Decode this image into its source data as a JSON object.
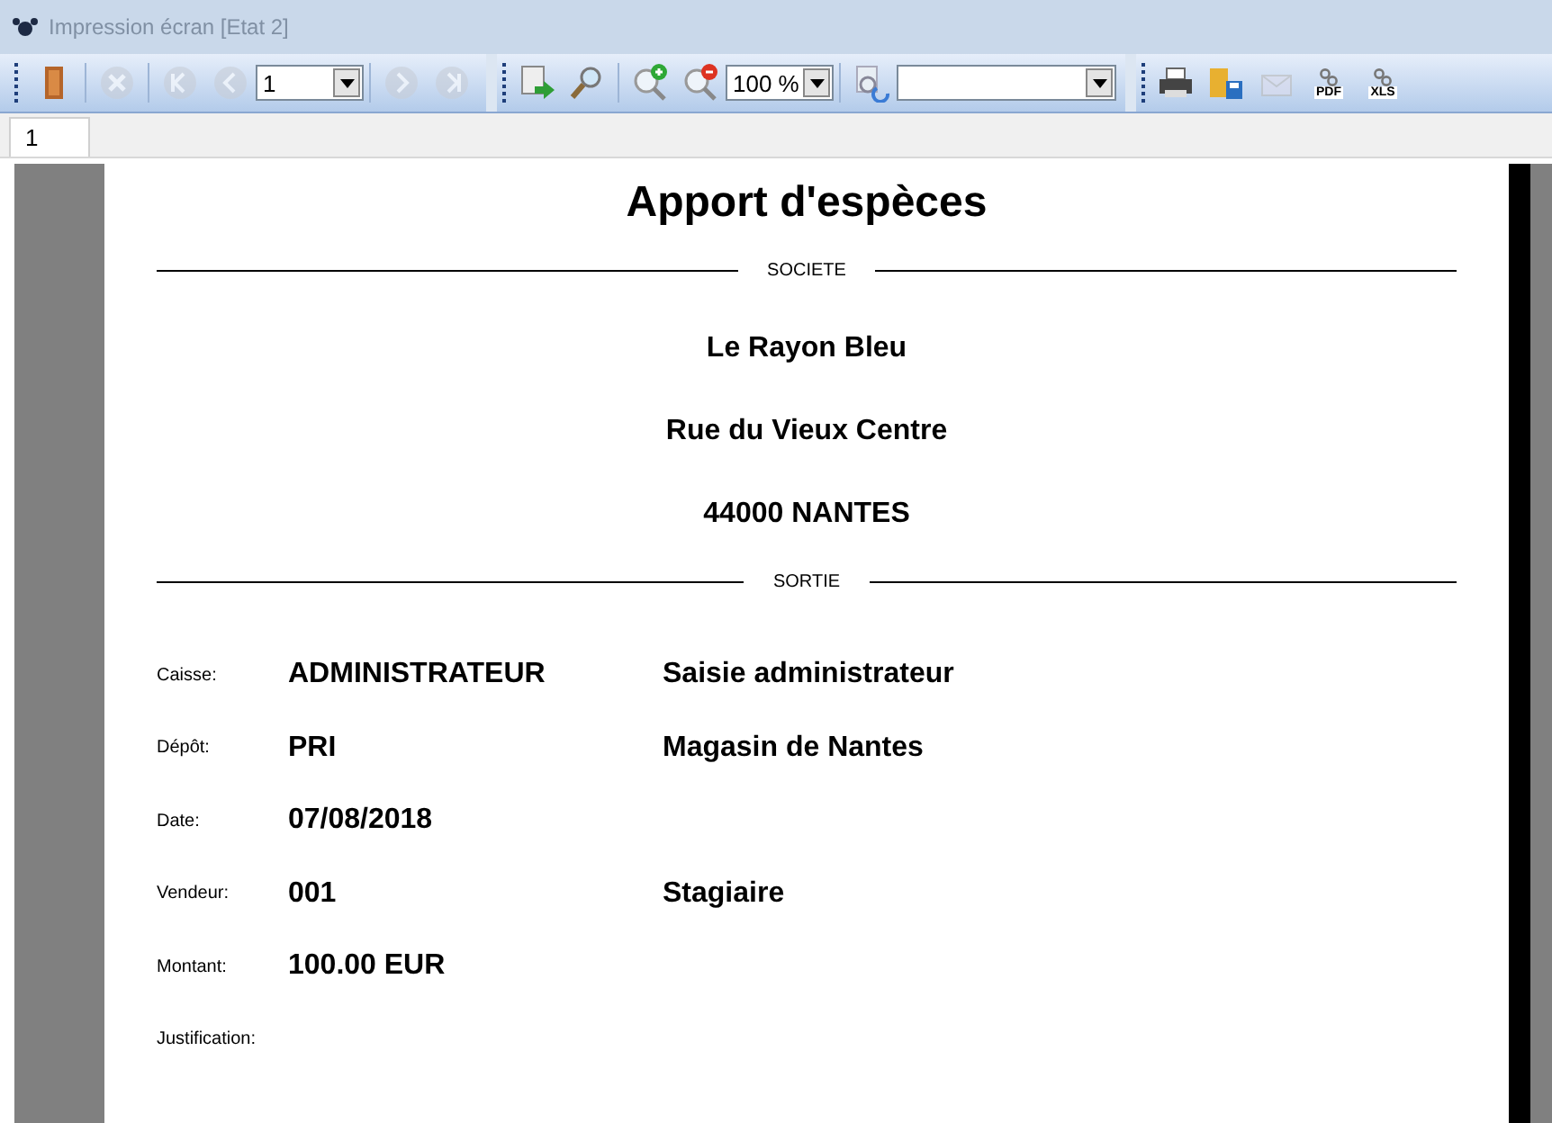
{
  "window": {
    "title": "Impression écran [Etat 2]"
  },
  "toolbar": [
    {
      "kind": "icon",
      "disabled": false
    },
    {
      "kind": "sep"
    },
    {
      "kind": "icon",
      "disabled": true
    },
    {
      "kind": "sep"
    },
    {
      "kind": "icon",
      "disabled": true
    },
    {
      "kind": "icon",
      "disabled": true
    },
    {
      "kind": "select",
      "value": "1"
    },
    {
      "kind": "sep"
    },
    {
      "kind": "icon",
      "disabled": true
    },
    {
      "kind": "icon",
      "disabled": true
    },
    {
      "kind": "group"
    },
    {
      "kind": "icon",
      "disabled": false
    },
    {
      "kind": "icon",
      "disabled": false
    },
    {
      "kind": "sep"
    },
    {
      "kind": "icon",
      "disabled": false
    },
    {
      "kind": "icon",
      "disabled": false
    },
    {
      "kind": "select",
      "value": "100 %"
    },
    {
      "kind": "sep"
    },
    {
      "kind": "icon",
      "disabled": false
    },
    {
      "kind": "combo"
    },
    {
      "kind": "group"
    },
    {
      "kind": "icon",
      "disabled": false
    },
    {
      "kind": "icon",
      "disabled": false
    },
    {
      "kind": "icon",
      "disabled": true
    },
    {
      "kind": "doc",
      "label": "PDF",
      "disabled": false
    },
    {
      "kind": "doc",
      "label": "XLS",
      "disabled": false
    }
  ],
  "tabs": [
    {
      "label": "1",
      "selected": true
    }
  ],
  "report": {
    "title": "Apport d'espèces",
    "sections": [
      {
        "heading": "SOCIETE",
        "lines": [
          "Le Rayon Bleu",
          "Rue du Vieux Centre",
          "44000 NANTES"
        ]
      },
      {
        "heading": "SORTIE"
      }
    ],
    "fields": [
      {
        "label": "Caisse:",
        "value": "ADMINISTRATEUR",
        "extra": "Saisie administrateur"
      },
      {
        "label": "Dépôt:",
        "value": "PRI",
        "extra": "Magasin de Nantes"
      },
      {
        "label": "Date:",
        "value": "07/08/2018"
      },
      {
        "label": "Vendeur:",
        "value": "001",
        "extra": "Stagiaire"
      },
      {
        "label": "Montant:",
        "value": "100.00 EUR"
      },
      {
        "label": "Justification:"
      }
    ]
  }
}
